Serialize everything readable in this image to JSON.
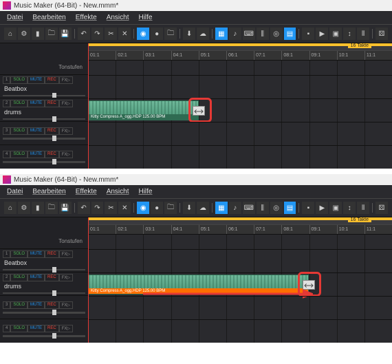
{
  "window_title": "Music Maker (64-Bit) - New.mmm*",
  "menu": [
    "Datei",
    "Bearbeiten",
    "Effekte",
    "Ansicht",
    "Hilfe"
  ],
  "ruler": {
    "label": "16 Takte",
    "ticks": [
      "01:1",
      "02:1",
      "03:1",
      "04:1",
      "05:1",
      "06:1",
      "07:1",
      "08:1",
      "09:1",
      "10:1",
      "11:1"
    ]
  },
  "tonstufen_label": "Tonstufen",
  "tracks": {
    "beatbox": {
      "num": "1",
      "name": "Beatbox",
      "solo": "SOLO",
      "mute": "MUTE",
      "rec": "REC",
      "fx": "FX▷"
    },
    "drums": {
      "num": "2",
      "name": "drums",
      "solo": "SOLO",
      "mute": "MUTE",
      "rec": "REC",
      "fx": "FX▷"
    },
    "t3": {
      "num": "3",
      "solo": "SOLO",
      "mute": "MUTE",
      "rec": "REC",
      "fx": "FX▷"
    },
    "t4": {
      "num": "4",
      "solo": "SOLO",
      "mute": "MUTE",
      "rec": "REC",
      "fx": "FX▷"
    }
  },
  "clip": {
    "label": "Kitty Compress A_ogg.HDP  125.00 BPM"
  }
}
